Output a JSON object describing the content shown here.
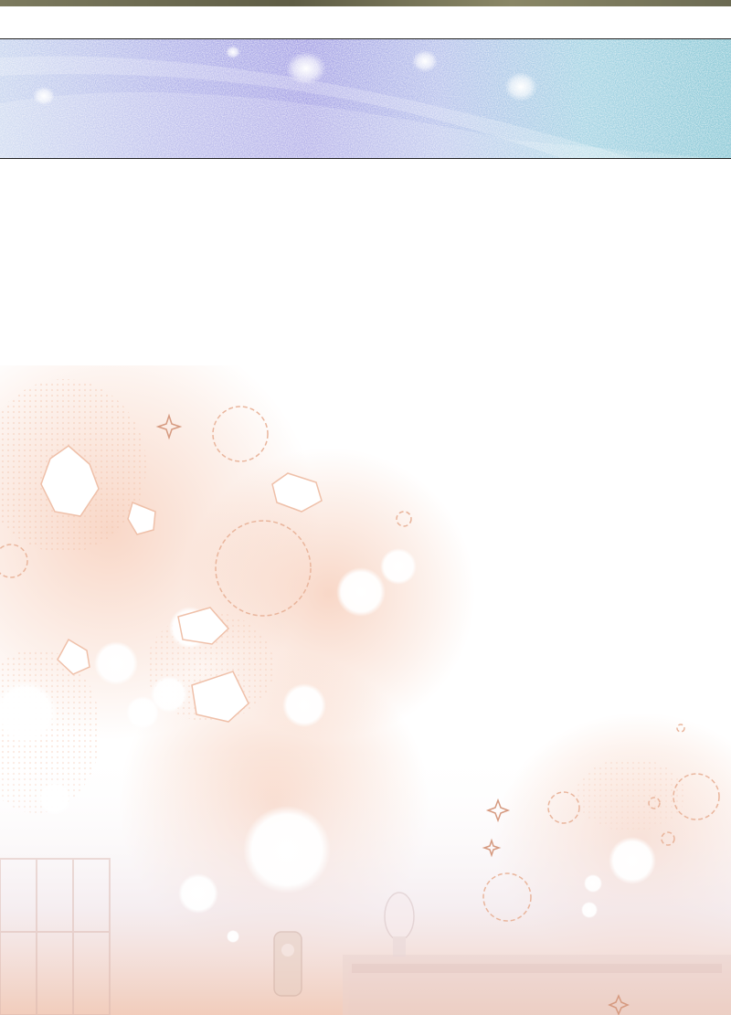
{
  "page": {
    "background": "#ffffff"
  },
  "top_strip": {
    "color": "#6b6a52"
  },
  "sky_panel": {
    "colors": [
      "#c9d6ef",
      "#a9a5e6",
      "#8fcad7"
    ],
    "border_color": "#222222"
  },
  "sparkle_scene": {
    "bokeh_color": "#f3b79a",
    "glow_color": "#ffffff",
    "floor_tint": "#f0c7b4"
  }
}
